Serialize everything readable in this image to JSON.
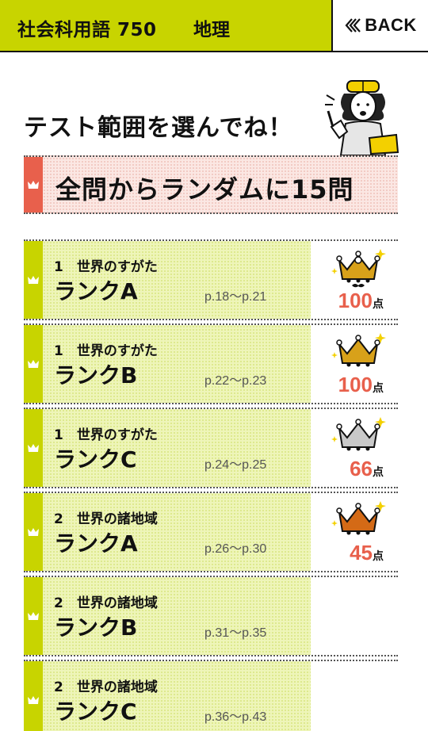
{
  "header": {
    "app_title": "社会科用語 750",
    "subject": "地理",
    "back_label": "BACK"
  },
  "heading": "テスト範囲を選んでね！",
  "random_test": {
    "label": "全問からランダムに15問"
  },
  "score_unit": "点",
  "colors": {
    "brand": "#c8d400",
    "accent": "#e8604c",
    "card": "#eef5b9"
  },
  "tests": [
    {
      "unit": "1　世界のすがた",
      "rank": "ランクA",
      "pages": "p.18〜p.21",
      "score": "100",
      "crown": "crown-gold-mustache-icon"
    },
    {
      "unit": "1　世界のすがた",
      "rank": "ランクB",
      "pages": "p.22〜p.23",
      "score": "100",
      "crown": "crown-gold-icon"
    },
    {
      "unit": "1　世界のすがた",
      "rank": "ランクC",
      "pages": "p.24〜p.25",
      "score": "66",
      "crown": "crown-silver-icon"
    },
    {
      "unit": "2　世界の諸地域",
      "rank": "ランクA",
      "pages": "p.26〜p.30",
      "score": "45",
      "crown": "crown-bronze-icon"
    },
    {
      "unit": "2　世界の諸地域",
      "rank": "ランクB",
      "pages": "p.31〜p.35"
    },
    {
      "unit": "2　世界の諸地域",
      "rank": "ランクC",
      "pages": "p.36〜p.43"
    }
  ]
}
